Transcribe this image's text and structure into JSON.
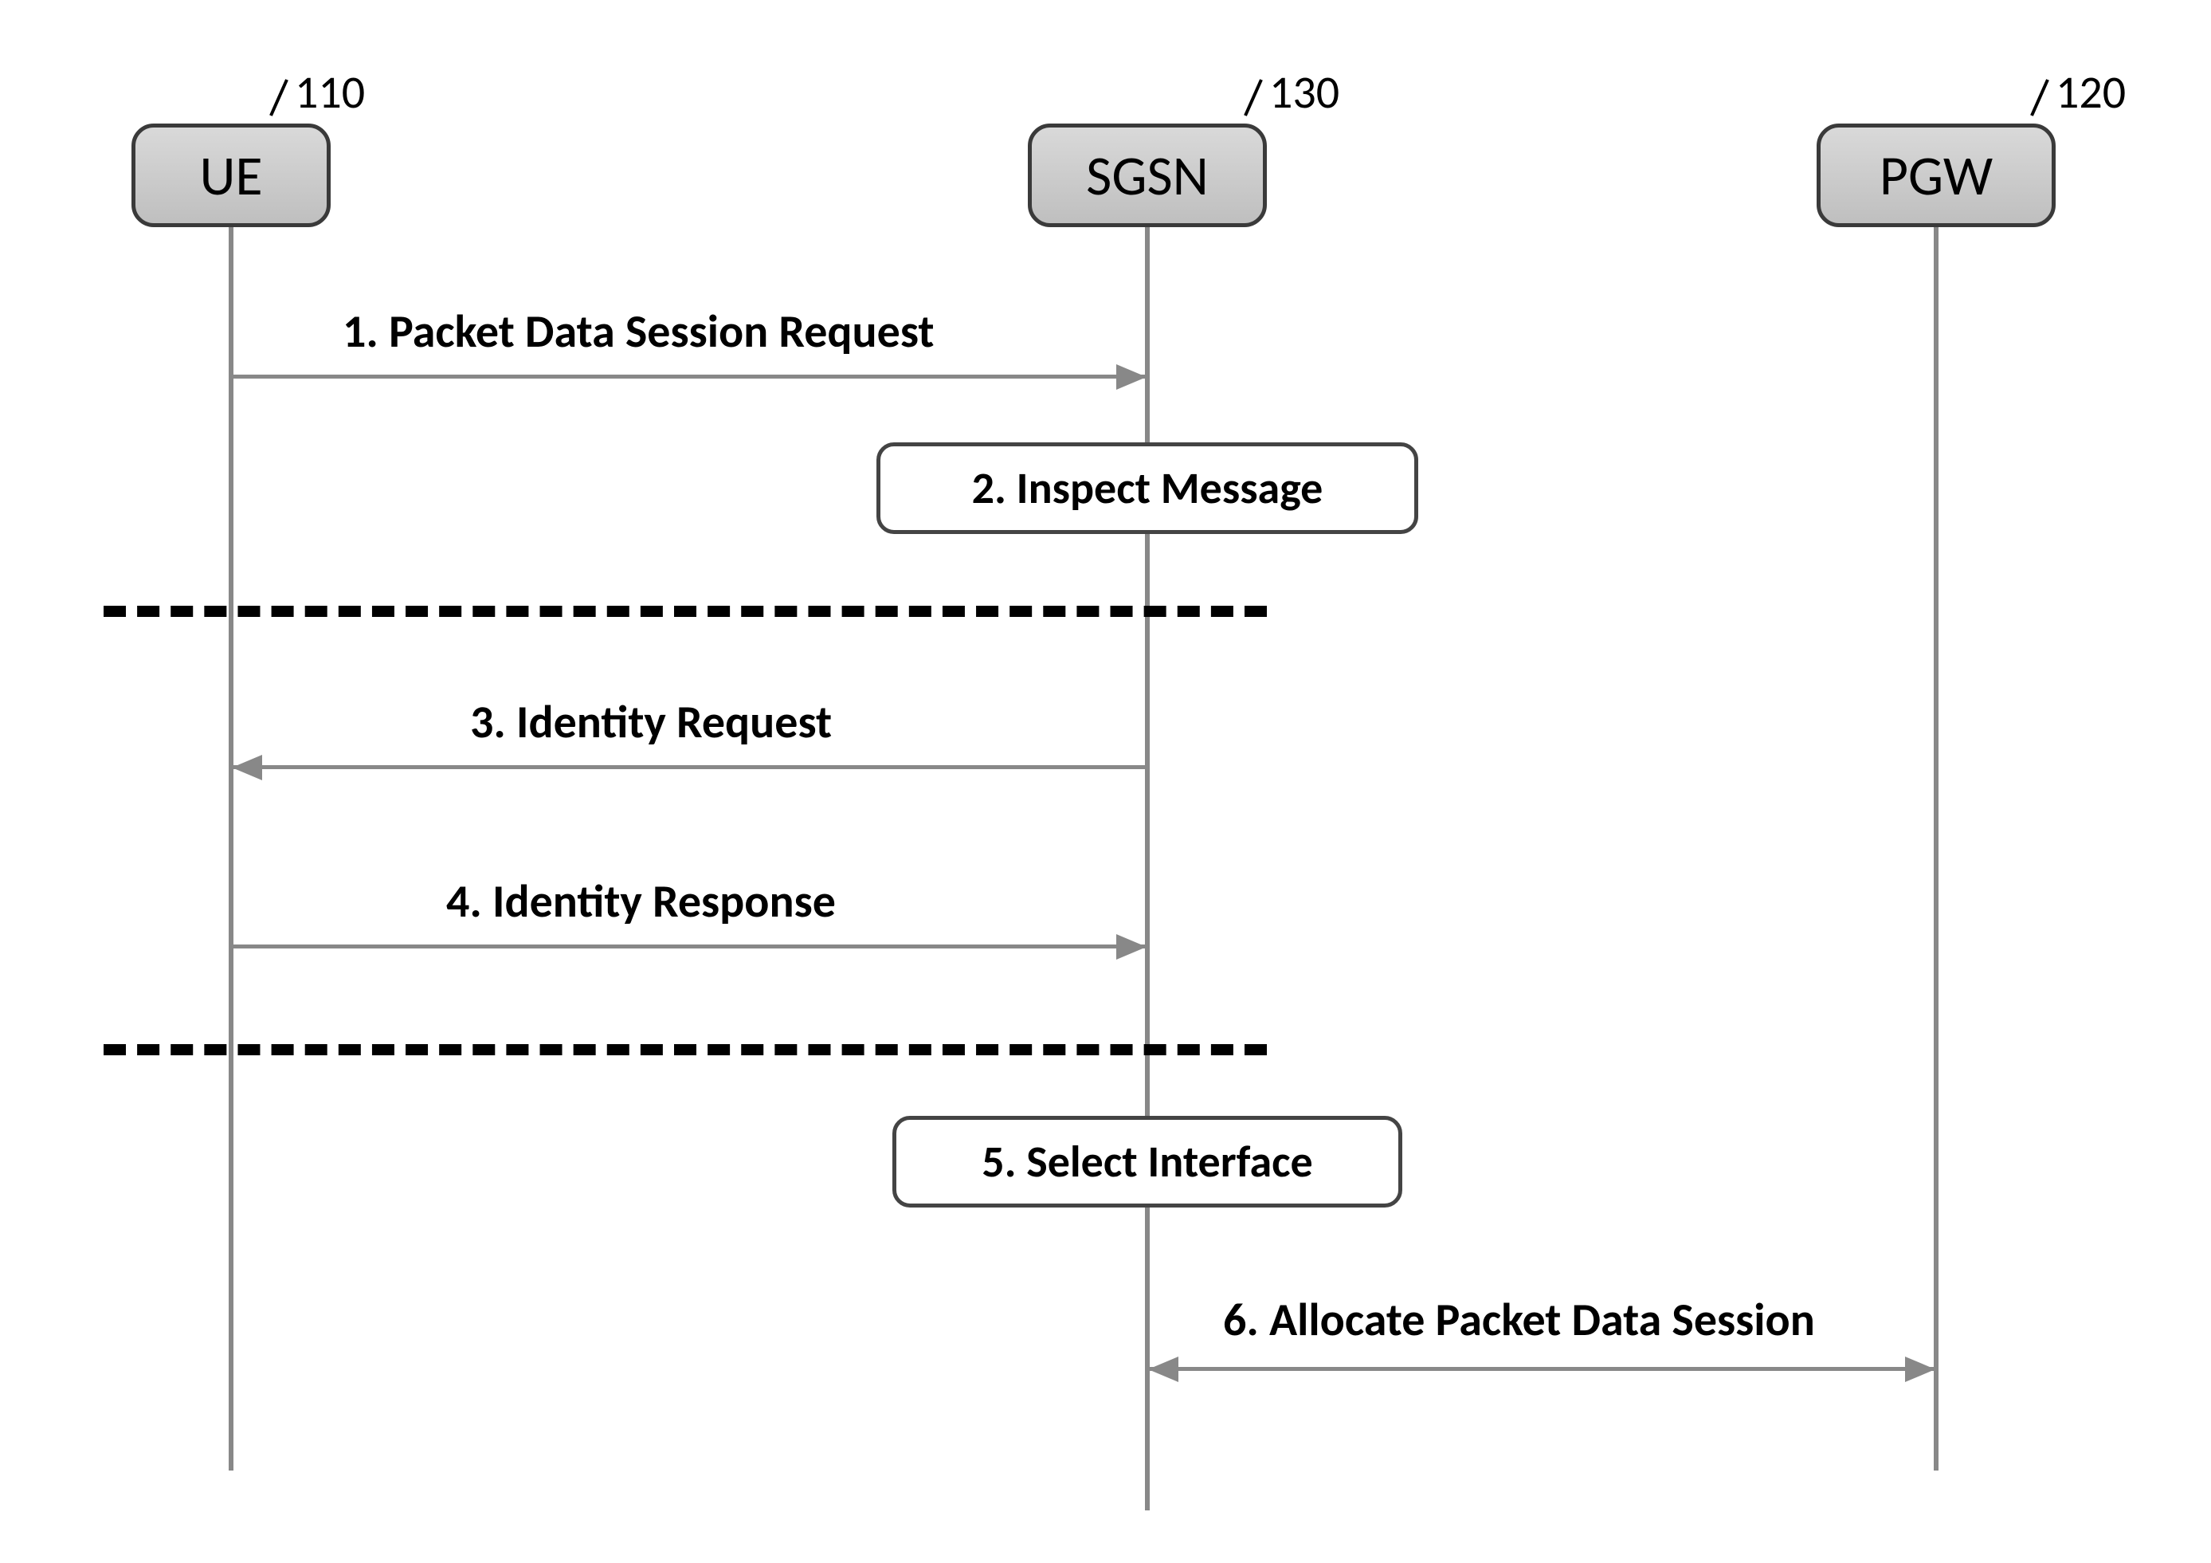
{
  "actors": {
    "ue": {
      "label": "UE",
      "ref": "110"
    },
    "sgsn": {
      "label": "SGSN",
      "ref": "130"
    },
    "pgw": {
      "label": "PGW",
      "ref": "120"
    }
  },
  "messages": {
    "m1": "1. Packet Data Session Request",
    "m2": "2. Inspect Message",
    "m3": "3. Identity Request",
    "m4": "4. Identity Response",
    "m5": "5. Select Interface",
    "m6": "6. Allocate Packet Data Session"
  }
}
